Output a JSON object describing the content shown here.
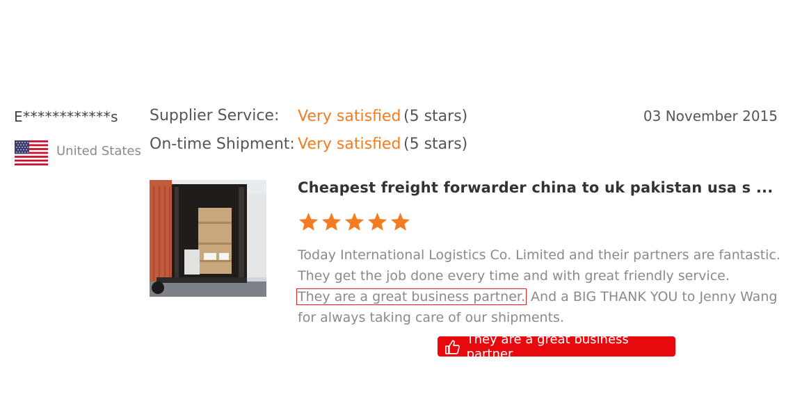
{
  "reviewer": {
    "name": "E************s",
    "country": "United States",
    "flag_icon": "us-flag-icon"
  },
  "ratings": [
    {
      "label": "Supplier Service:",
      "value": "Very satisfied",
      "stars": "(5 stars)"
    },
    {
      "label": "On-time Shipment:",
      "value": "Very satisfied",
      "stars": "(5 stars)"
    }
  ],
  "date": "03 November 2015",
  "review": {
    "title": "Cheapest freight forwarder china to uk pakistan usa s ...",
    "star_rating": 5,
    "text_before": "Today International Logistics Co. Limited and their partners are fantastic. They get the job done every time and with great friendly service.",
    "text_highlight": "They are a great business partner.",
    "text_after": "And a BIG THANK YOU to Jenny Wang for always taking care of our shipments.",
    "photo_icon": "shipping-container-photo"
  },
  "badge": {
    "icon": "thumbs-up-icon",
    "label": "They are a great business partner"
  },
  "colors": {
    "accent": "#f47c20",
    "badge": "#e8090f",
    "muted_text": "#8a8a8a"
  }
}
